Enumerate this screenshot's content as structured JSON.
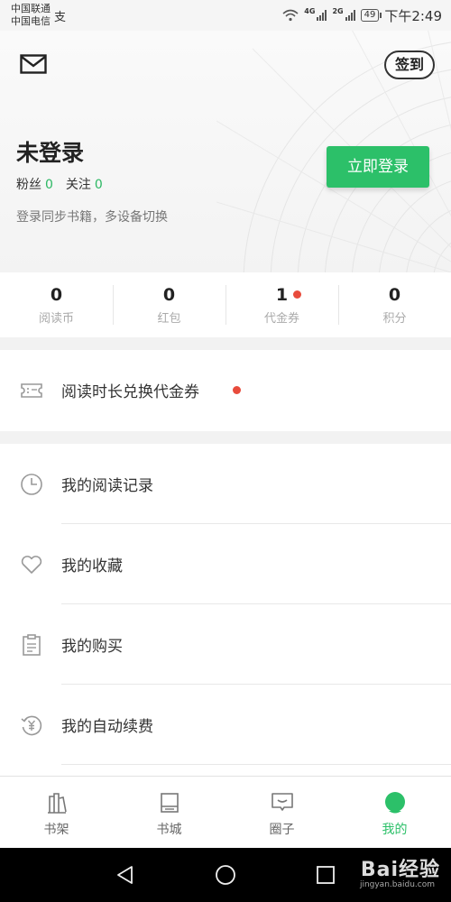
{
  "status_bar": {
    "carrier_1": "中国联通",
    "carrier_2": "中国电信",
    "extra_icon_text": "支",
    "net_1": "4G",
    "net_2": "2G",
    "battery": "49",
    "time": "下午2:49"
  },
  "header": {
    "signin_label": "签到",
    "user_name": "未登录",
    "fans_label": "粉丝",
    "fans_count": "0",
    "follow_label": "关注",
    "follow_count": "0",
    "sync_hint": "登录同步书籍，多设备切换",
    "login_button": "立即登录"
  },
  "stats": [
    {
      "value": "0",
      "label": "阅读币"
    },
    {
      "value": "0",
      "label": "红包"
    },
    {
      "value": "1",
      "label": "代金券",
      "badge": true
    },
    {
      "value": "0",
      "label": "积分"
    }
  ],
  "voucher_row": {
    "label": "阅读时长兑换代金券",
    "icon": "ticket-icon"
  },
  "menu": [
    {
      "label": "我的阅读记录",
      "icon": "clock-icon"
    },
    {
      "label": "我的收藏",
      "icon": "heart-icon"
    },
    {
      "label": "我的购买",
      "icon": "clipboard-icon"
    },
    {
      "label": "我的自动续费",
      "icon": "yuan-renew-icon"
    }
  ],
  "tabs": [
    {
      "label": "书架",
      "icon": "bookshelf-icon"
    },
    {
      "label": "书城",
      "icon": "bookstore-icon"
    },
    {
      "label": "圈子",
      "icon": "chat-icon"
    },
    {
      "label": "我的",
      "icon": "profile-icon",
      "active": true
    }
  ],
  "watermark": {
    "text": "Bai经验",
    "sub": "jingyan.baidu.com"
  },
  "colors": {
    "accent": "#2cc069",
    "badge": "#e84b3c"
  }
}
